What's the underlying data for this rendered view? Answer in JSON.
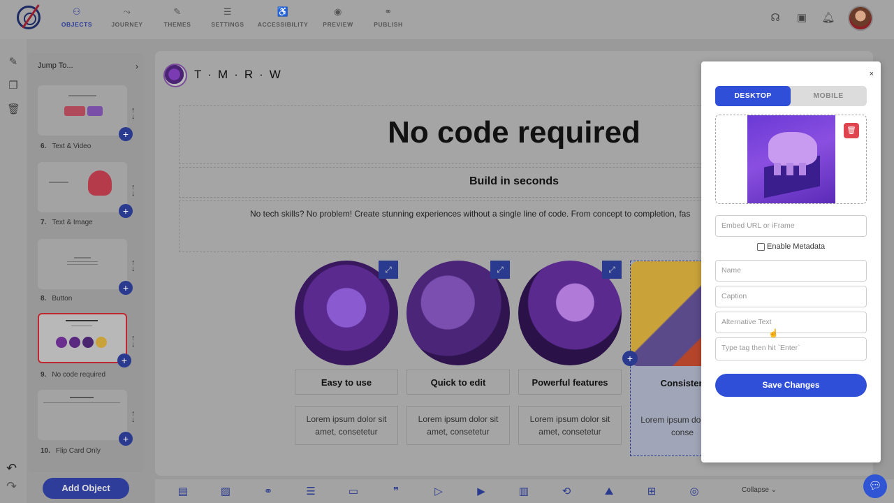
{
  "nav": {
    "items": [
      {
        "label": "OBJECTS",
        "icon": "objects-icon",
        "glyph": "⚇"
      },
      {
        "label": "JOURNEY",
        "icon": "journey-icon",
        "glyph": "⤳"
      },
      {
        "label": "THEMES",
        "icon": "themes-icon",
        "glyph": "✎"
      },
      {
        "label": "SETTINGS",
        "icon": "settings-icon",
        "glyph": "☰"
      },
      {
        "label": "ACCESSIBILITY",
        "icon": "accessibility-icon",
        "glyph": "♿"
      },
      {
        "label": "PREVIEW",
        "icon": "preview-icon",
        "glyph": "◉"
      },
      {
        "label": "PUBLISH",
        "icon": "publish-icon",
        "glyph": "⚭"
      }
    ],
    "active_index": 0
  },
  "sidebar": {
    "jump_label": "Jump To...",
    "slides": [
      {
        "number": "6.",
        "label": "Text & Video"
      },
      {
        "number": "7.",
        "label": "Text & Image"
      },
      {
        "number": "8.",
        "label": "Button"
      },
      {
        "number": "9.",
        "label": "No code required"
      },
      {
        "number": "10.",
        "label": "Flip Card Only"
      }
    ],
    "active_index": 3,
    "add_object_label": "Add Object"
  },
  "canvas": {
    "brand": "T·M·R·W",
    "title": "No code required",
    "subtitle": "Build in seconds",
    "body": "No tech skills? No problem! Create stunning experiences without a single line of code. From concept to completion, fas",
    "cards": [
      {
        "title": "Easy to use",
        "text": "Lorem ipsum dolor sit amet, consetetur"
      },
      {
        "title": "Quick to edit",
        "text": "Lorem ipsum dolor sit amet, consetetur"
      },
      {
        "title": "Powerful features",
        "text": "Lorem ipsum dolor sit amet, consetetur"
      },
      {
        "title": "Consisten",
        "text": "Lorem ipsum do amet, conse"
      }
    ]
  },
  "bottombar": {
    "collapse_label": "Collapse"
  },
  "modal": {
    "close": "×",
    "tabs": [
      "DESKTOP",
      "MOBILE"
    ],
    "active_tab": 0,
    "embed_placeholder": "Embed URL or iFrame",
    "metadata_label": "Enable Metadata",
    "name_placeholder": "Name",
    "caption_placeholder": "Caption",
    "alt_placeholder": "Alternative Text",
    "tags_placeholder": "Type tag then hit `Enter`",
    "save_label": "Save Changes"
  },
  "colors": {
    "primary": "#2f4fd8",
    "accent_dark": "#2a3a8f",
    "danger": "#e0454f",
    "active_border": "#c0282f"
  }
}
